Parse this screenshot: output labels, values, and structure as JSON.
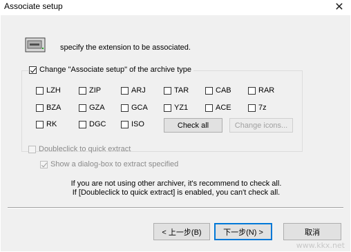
{
  "window": {
    "title": "Associate setup",
    "close_glyph": "✕"
  },
  "intro_text": "specify the extension to be associated.",
  "group": {
    "label": "Change \"Associate setup\" of the archive type",
    "checked": true
  },
  "extensions": [
    [
      "LZH",
      "ZIP",
      "ARJ",
      "TAR",
      "CAB",
      "RAR"
    ],
    [
      "BZA",
      "GZA",
      "GCA",
      "YZ1",
      "ACE",
      "7z"
    ],
    [
      "RK",
      "DGC",
      "ISO"
    ]
  ],
  "buttons": {
    "check_all": "Check all",
    "change_icons": "Change icons...",
    "back": "< 上一步(B)",
    "next": "下一步(N) >",
    "cancel": "取消"
  },
  "options": {
    "doubleclick": "Doubleclick to quick extract",
    "show_dialog": "Show a dialog-box to extract specified"
  },
  "notes": {
    "line1": "If you are not using other archiver, it's recommend to check all.",
    "line2": "If [Doubleclick to quick extract] is enabled, you can't check all."
  },
  "watermark": "www.kkx.net"
}
